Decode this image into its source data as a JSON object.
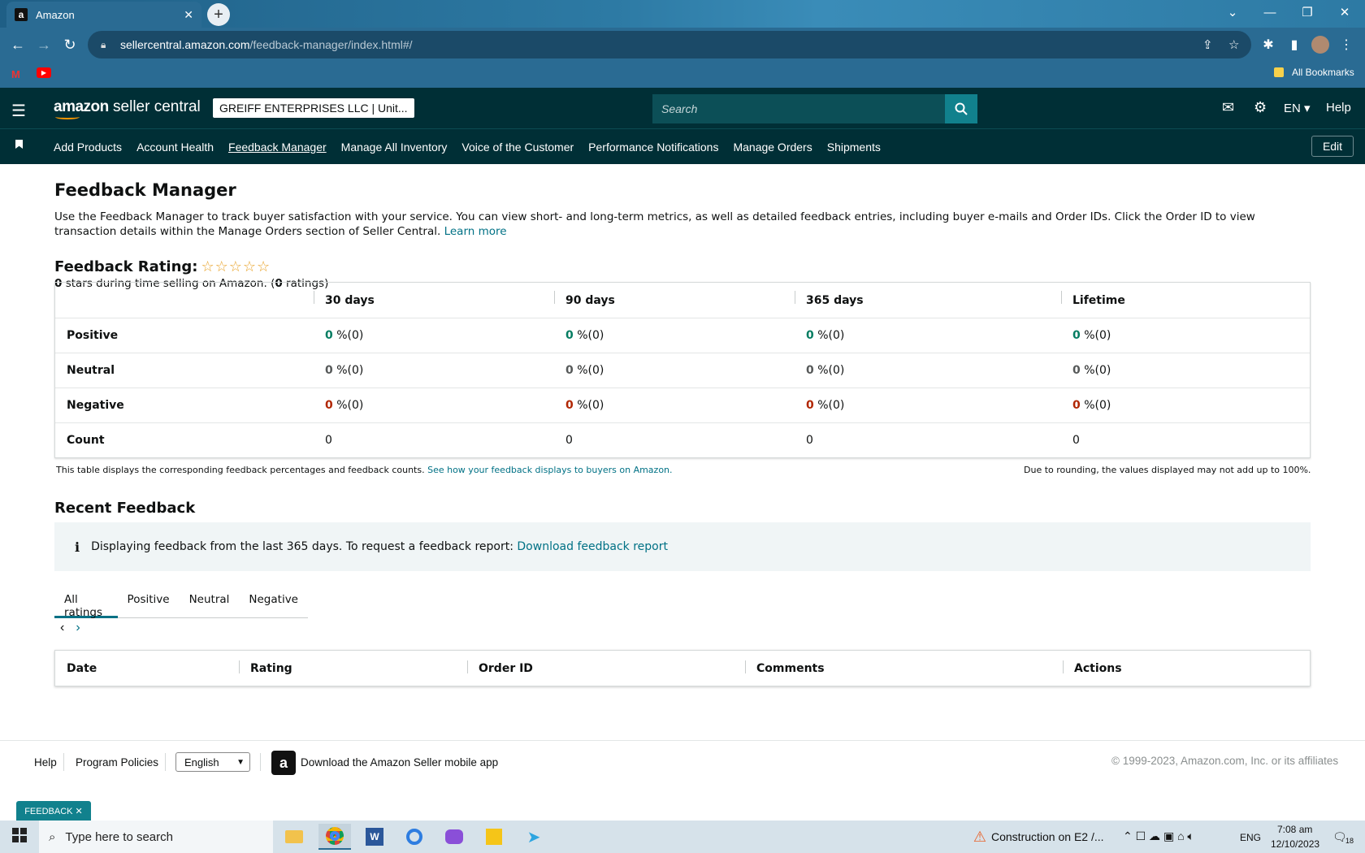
{
  "browser": {
    "tab_title": "Amazon",
    "tab_favicon": "a",
    "url_host": "sellercentral.amazon.com",
    "url_path": "/feedback-manager/index.html#/",
    "bookmarks_label": "All Bookmarks"
  },
  "header": {
    "logo_main": "amazon",
    "logo_sub": " seller central",
    "account": "GREIFF ENTERPRISES LLC | Unit...",
    "search_placeholder": "Search",
    "lang": "EN ▾",
    "help": "Help"
  },
  "nav": {
    "links": [
      "Add Products",
      "Account Health",
      "Feedback Manager",
      "Manage All Inventory",
      "Voice of the Customer",
      "Performance Notifications",
      "Manage Orders",
      "Shipments"
    ],
    "edit": "Edit"
  },
  "page": {
    "title": "Feedback Manager",
    "intro": "Use the Feedback Manager to track buyer satisfaction with your service. You can view short- and long-term metrics, as well as detailed feedback entries, including buyer e-mails and Order IDs. Click the Order ID to view transaction details within the Manage Orders section of Seller Central.",
    "learn_more": "Learn more",
    "rating_label": "Feedback Rating:",
    "stars": "☆☆☆☆☆",
    "rating_stars_count": "0",
    "rating_text_mid": " stars during time selling on Amazon. (",
    "rating_count": "0",
    "rating_text_end": " ratings)"
  },
  "feedback_table": {
    "columns": [
      "30 days",
      "90 days",
      "365 days",
      "Lifetime"
    ],
    "rows": [
      {
        "label": "Positive",
        "values": [
          "0",
          "0",
          "0",
          "0"
        ],
        "suffix": " %(0)"
      },
      {
        "label": "Neutral",
        "values": [
          "0",
          "0",
          "0",
          "0"
        ],
        "suffix": " %(0)"
      },
      {
        "label": "Negative",
        "values": [
          "0",
          "0",
          "0",
          "0"
        ],
        "suffix": " %(0)"
      },
      {
        "label": "Count",
        "values": [
          "0",
          "0",
          "0",
          "0"
        ],
        "suffix": ""
      }
    ],
    "note": "This table displays the corresponding feedback percentages and feedback counts.",
    "note_link": "See how your feedback displays to buyers on Amazon.",
    "rounding_note": "Due to rounding, the values displayed may not add up to 100%."
  },
  "recent": {
    "title": "Recent Feedback",
    "info": "Displaying feedback from the last 365 days. To request a feedback report:",
    "info_link": "Download feedback report",
    "tabs": [
      "All ratings",
      "Positive",
      "Neutral",
      "Negative"
    ],
    "columns": [
      "Date",
      "Rating",
      "Order ID",
      "Comments",
      "Actions"
    ]
  },
  "footer": {
    "help": "Help",
    "policies": "Program Policies",
    "language": "English",
    "app": "Download the Amazon Seller mobile app",
    "copyright": "© 1999-2023, Amazon.com, Inc. or its affiliates",
    "feedback_tag": "FEEDBACK ✕"
  },
  "taskbar": {
    "search_placeholder": "Type here to search",
    "news": "Construction on E2 /...",
    "lang": "ENG",
    "time": "7:08 am",
    "date": "12/10/2023",
    "notif_count": "18"
  },
  "colors": {
    "header_bg": "#002f36",
    "link": "#007185",
    "positive": "#067d62",
    "negative": "#b12704",
    "star": "#e8a32a"
  }
}
